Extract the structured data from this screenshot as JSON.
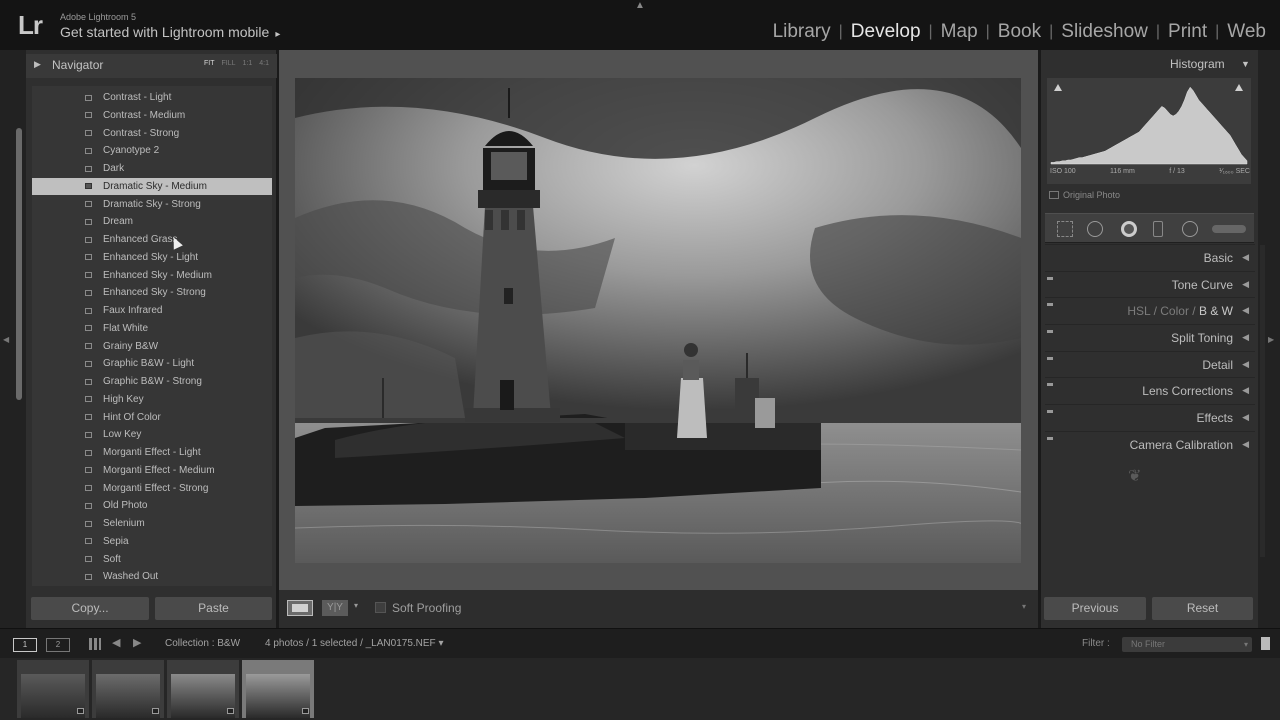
{
  "app": {
    "logo": "Lr",
    "product_name": "Adobe Lightroom 5",
    "mobile_cta": "Get started with Lightroom mobile",
    "mobile_cta_arrow": "▸"
  },
  "modules": [
    {
      "label": "Library",
      "active": false
    },
    {
      "label": "Develop",
      "active": true
    },
    {
      "label": "Map",
      "active": false
    },
    {
      "label": "Book",
      "active": false
    },
    {
      "label": "Slideshow",
      "active": false
    },
    {
      "label": "Print",
      "active": false
    },
    {
      "label": "Web",
      "active": false
    }
  ],
  "module_separator": "|",
  "navigator": {
    "title": "Navigator",
    "zoom_options": [
      "FIT",
      "FILL",
      "1:1",
      "4:1"
    ],
    "active_zoom": "FIT"
  },
  "presets": [
    "Contrast - Light",
    "Contrast - Medium",
    "Contrast - Strong",
    "Cyanotype 2",
    "Dark",
    "Dramatic Sky - Medium",
    "Dramatic Sky - Strong",
    "Dream",
    "Enhanced Grass",
    "Enhanced Sky - Light",
    "Enhanced Sky - Medium",
    "Enhanced Sky - Strong",
    "Faux Infrared",
    "Flat White",
    "Grainy B&W",
    "Graphic B&W - Light",
    "Graphic B&W - Strong",
    "High Key",
    "Hint Of Color",
    "Low Key",
    "Morganti Effect - Light",
    "Morganti Effect - Medium",
    "Morganti Effect - Strong",
    "Old Photo",
    "Selenium",
    "Sepia",
    "Soft",
    "Washed Out"
  ],
  "selected_preset": "Dramatic Sky - Medium",
  "left_buttons": {
    "copy": "Copy...",
    "paste": "Paste"
  },
  "toolbar": {
    "yy_label": "Y|Y",
    "yy_dropdown": "▾",
    "soft_proofing": "Soft Proofing",
    "dropdown": "▾",
    "soft_proofing_checked": false
  },
  "histogram": {
    "title": "Histogram",
    "iso": "ISO 100",
    "focal": "116 mm",
    "aperture": "f / 13",
    "shutter": "¹⁄₁₆₀₀ SEC",
    "original_photo": "Original Photo",
    "levels": [
      2,
      2,
      3,
      3,
      4,
      4,
      5,
      5,
      6,
      7,
      8,
      8,
      9,
      10,
      11,
      12,
      13,
      14,
      15,
      16,
      18,
      20,
      22,
      24,
      26,
      28,
      30,
      32,
      34,
      36,
      38,
      40,
      44,
      48,
      52,
      56,
      60,
      64,
      68,
      72,
      70,
      66,
      62,
      60,
      62,
      66,
      72,
      80,
      90,
      96,
      92,
      86,
      80,
      76,
      72,
      68,
      64,
      60,
      56,
      52,
      48,
      44,
      40,
      36,
      30,
      24,
      18,
      12,
      8,
      4
    ]
  },
  "develop_tools": [
    "crop-overlay",
    "spot-removal",
    "red-eye-correction",
    "graduated-filter",
    "radial-filter",
    "adjustment-brush"
  ],
  "panels": {
    "basic": "Basic",
    "tone_curve": "Tone Curve",
    "hsl": "HSL",
    "hsl_sep1": "/",
    "color": "Color",
    "hsl_sep2": "/",
    "bw": "B & W",
    "split_toning": "Split Toning",
    "detail": "Detail",
    "lens_corrections": "Lens Corrections",
    "effects": "Effects",
    "camera_calibration": "Camera Calibration",
    "panel_end": "❦"
  },
  "right_buttons": {
    "previous": "Previous",
    "reset": "Reset"
  },
  "filmstrip": {
    "view1": "1",
    "view2": "2",
    "source": "Collection : B&W",
    "count": "4 photos / 1 selected / _LAN0175.NEF ▾",
    "filter_label": "Filter :",
    "filter_value": "No Filter",
    "filter_dropdown": "▾",
    "thumbnails": [
      {
        "name": "thumbnail-1",
        "selected": false,
        "tone": "#5a5a5a"
      },
      {
        "name": "thumbnail-2",
        "selected": false,
        "tone": "#6c6c6c"
      },
      {
        "name": "thumbnail-3",
        "selected": false,
        "tone": "#8a8a8a"
      },
      {
        "name": "thumbnail-4",
        "selected": true,
        "tone": "#9a9a9a"
      }
    ]
  }
}
